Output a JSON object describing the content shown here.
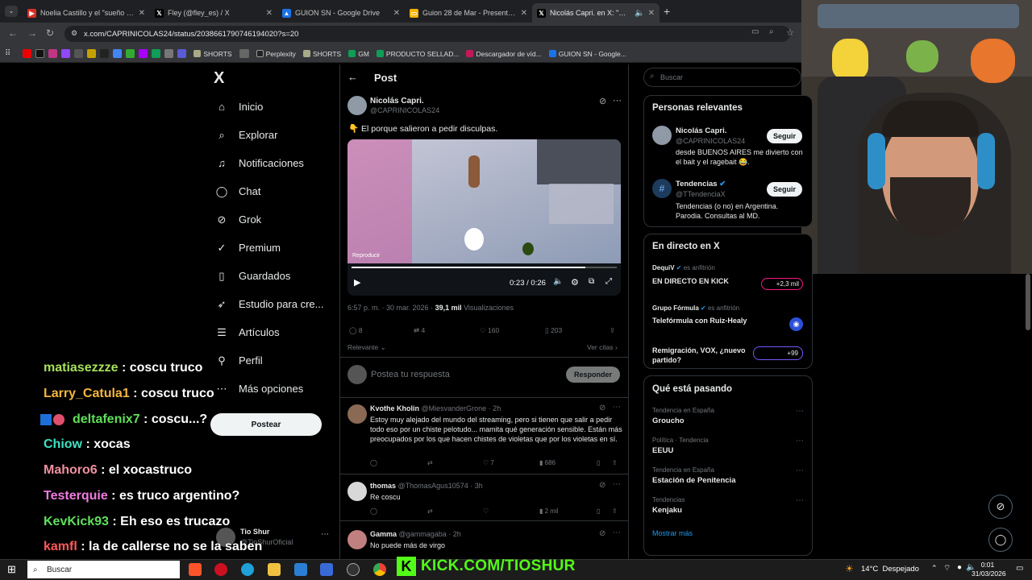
{
  "browser": {
    "tabs": [
      {
        "title": "Noelia Castillo y el \"sueño de tr",
        "fav": "#d93025",
        "glyph": "▶"
      },
      {
        "title": "Fley (@fley_es) / X",
        "fav": "#000",
        "glyph": "𝕏"
      },
      {
        "title": "GUION SN - Google Drive",
        "fav": "#1a73e8",
        "glyph": "▲"
      },
      {
        "title": "Guion 28 de Mar - Presentación",
        "fav": "#f4b400",
        "glyph": "▭"
      },
      {
        "title": "Nicolás Capri. en X: \"@TTen",
        "fav": "#000",
        "glyph": "𝕏"
      }
    ],
    "url": "x.com/CAPRINICOLAS24/status/2038661790746194020?s=20",
    "bookmarks": [
      "SHORTS",
      "Perplexity",
      "SHORTS",
      "GM",
      "PRODUCTO SELLAD...",
      "Descargador de víd...",
      "GUION SN - Google..."
    ]
  },
  "nav": {
    "logo": "X",
    "items": [
      "Inicio",
      "Explorar",
      "Notificaciones",
      "Chat",
      "Grok",
      "Premium",
      "Guardados",
      "Estudio para cre...",
      "Artículos",
      "Perfil",
      "Más opciones"
    ],
    "post_label": "Postear",
    "account_name": "Tio Shur",
    "account_handle": "@TioShurOficial"
  },
  "chat_overlay": [
    {
      "user": "matiasezzze",
      "msg": " : coscu truco",
      "color": "#a8e05a"
    },
    {
      "user": "Larry_Catula1",
      "msg": " : coscu truco",
      "color": "#f4b63f"
    },
    {
      "user": "deltafenix7",
      "msg": " : coscu...?",
      "color": "#5fe05a"
    },
    {
      "user": "Chiow",
      "msg": " : xocas",
      "color": "#40e0c0"
    },
    {
      "user": "Mahoro6",
      "msg": " : el xocastruco",
      "color": "#f090a0"
    },
    {
      "user": "Testerquie",
      "msg": " : es truco argentino?",
      "color": "#f07be0"
    },
    {
      "user": "KevKick93",
      "msg": " : Eh eso es trucazo",
      "color": "#5fe05a"
    },
    {
      "user": "kamfl",
      "msg": " : la de callerse no se la saben",
      "color": "#ff5a5a"
    }
  ],
  "post": {
    "header": "Post",
    "author": "Nicolás Capri.",
    "handle": "@CAPRINICOLAS24",
    "text": "👇 El porque  salieron a pedir disculpas.",
    "video_label": "Reproducir",
    "video_time": "0:23 / 0:26",
    "video_progress": 0.88,
    "timestamp": "6:57 p. m. · 30 mar. 2026 · ",
    "views_count": "39,1 mil",
    "views_label": " Visualizaciones",
    "replies": "8",
    "reposts": "4",
    "likes": "160",
    "bookmarks": "203",
    "sort": "Relevante",
    "quotes": "Ver citas",
    "reply_placeholder": "Postea tu respuesta",
    "reply_button": "Responder"
  },
  "replies": [
    {
      "name": "Kvothe Kholin",
      "handle": "@MiesvanderGrone · 2h",
      "text": "Estoy muy alejado del mundo del streaming, pero si tienen que salir a pedir todo eso por un chiste pelotudo... mamita qué generación sensible. Están más preocupados por los que hacen chistes de violetas que por los violetas en sí.",
      "likes": "7",
      "views": "686",
      "av": "#8a6a55"
    },
    {
      "name": "thomas",
      "handle": "@ThomasAgus10574 · 3h",
      "text": "Re coscu",
      "likes": "",
      "views": "2 mil",
      "av": "#d8d8d8"
    },
    {
      "name": "Gamma",
      "handle": "@gammagaba · 2h",
      "text": "No puede más de virgo",
      "likes": "",
      "views": "",
      "av": "#c08080"
    }
  ],
  "right": {
    "search_placeholder": "Buscar",
    "relevant_title": "Personas relevantes",
    "people": [
      {
        "name": "Nicolás Capri.",
        "handle": "@CAPRINICOLAS24",
        "bio": "desde BUENOS AIRES me divierto con el bait y el ragebait 😂.",
        "button": "Seguir"
      },
      {
        "name": "Tendencias",
        "handle": "@TTendenciaX",
        "bio": "Tendencias (o no) en Argentina. Parodia. Consultas al MD.",
        "button": "Seguir"
      }
    ],
    "live_title": "En directo en X",
    "lives": [
      {
        "host": "DequiV",
        "role": "es anfitrión",
        "title": "EN DIRECTO EN KICK",
        "badge": "+2,3 mil"
      },
      {
        "host": "Grupo Fórmula",
        "role": "es anfitrión",
        "title": "Telefórmula con Ruiz-Healy",
        "badge": ""
      },
      {
        "host": "",
        "role": "",
        "title": "Remigración, VOX, ¿nuevo partido?",
        "badge": "+99"
      }
    ],
    "trends_title": "Qué está pasando",
    "trends": [
      {
        "context": "Tendencia en España",
        "name": "Groucho"
      },
      {
        "context": "Política · Tendencia",
        "name": "EEUU"
      },
      {
        "context": "Tendencia en España",
        "name": "Estación de Penitencia"
      },
      {
        "context": "Tendencias",
        "name": "Kenjaku"
      }
    ],
    "show_more": "Mostrar más"
  },
  "taskbar": {
    "search": "Buscar",
    "kick": "KICK.COM/TIOSHUR",
    "weather": "14°C  Despejado",
    "time": "0:01",
    "date": "31/03/2026"
  }
}
